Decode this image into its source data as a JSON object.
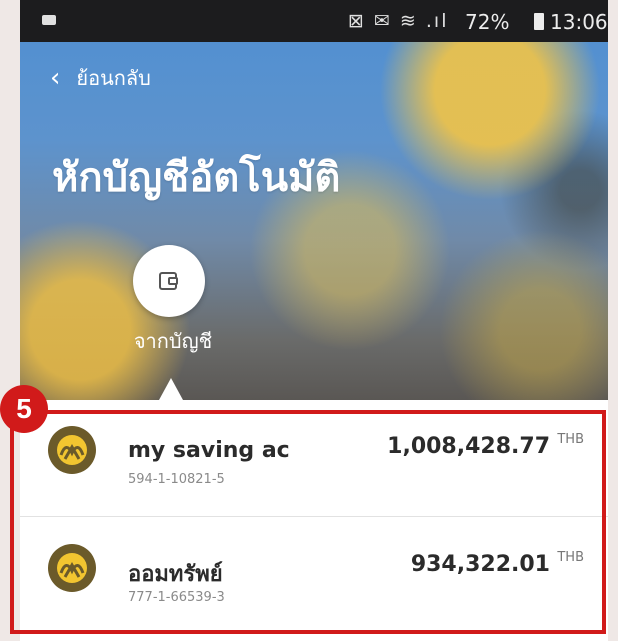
{
  "status_bar": {
    "icons": "⊠ ✉ ≋ .ıl",
    "battery_percent": "72%",
    "time": "13:06"
  },
  "nav": {
    "back_label": "ย้อนกลับ"
  },
  "page": {
    "title": "หักบัญชีอัตโนมัติ"
  },
  "source": {
    "label": "จากบัญชี"
  },
  "accounts": [
    {
      "name": "my saving ac",
      "number": "594-1-10821-5",
      "amount": "1,008,428.77",
      "currency": "THB"
    },
    {
      "name": "ออมทรัพย์",
      "number": "777-1-66539-3",
      "amount": "934,322.01",
      "currency": "THB"
    }
  ],
  "annotation": {
    "step": "5",
    "color": "#d11a1a"
  },
  "colors": {
    "bank_logo": "#6b5a2a",
    "bank_logo_mark": "#f2c530"
  }
}
